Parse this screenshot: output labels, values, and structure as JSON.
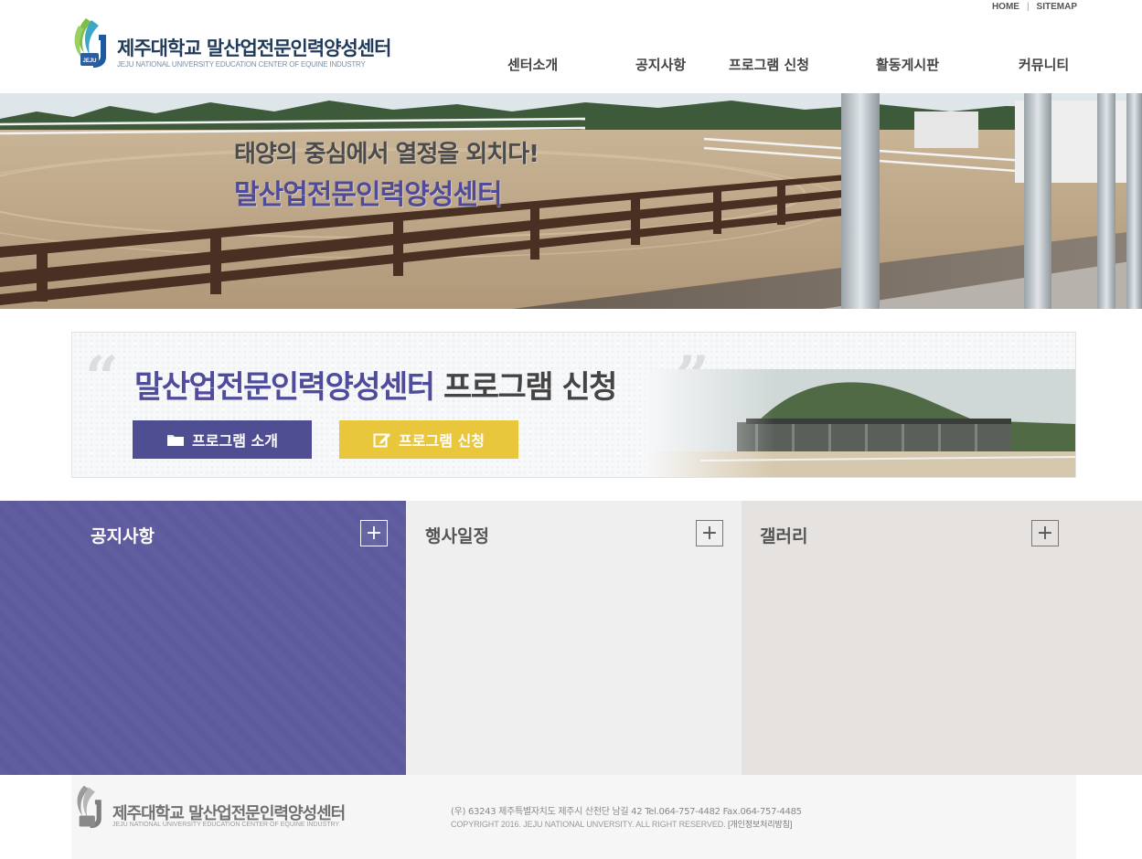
{
  "utility": {
    "home": "HOME",
    "separator": "|",
    "sitemap": "SITEMAP"
  },
  "logo": {
    "title": "제주대학교 말산업전문인력양성센터",
    "subtitle": "JEJU NATIONAL UNIVERSITY EDUCATION CENTER OF EQUINE INDUSTRY",
    "emblem_text": "JEJU"
  },
  "nav": [
    {
      "label": "센터소개"
    },
    {
      "label": "공지사항"
    },
    {
      "label": "프로그램 신청"
    },
    {
      "label": "활동게시판"
    },
    {
      "label": "커뮤니티"
    }
  ],
  "hero": {
    "line1": "태양의 중심에서 열정을 외치다!",
    "line2": "말산업전문인력양성센터"
  },
  "banner": {
    "quote_open": "“",
    "quote_close": "”",
    "title_accent": "말산업전문인력양성센터",
    "title_plain": "프로그램 신청",
    "btn_intro": "프로그램 소개",
    "btn_apply": "프로그램 신청"
  },
  "panels": {
    "notice": {
      "title": "공지사항",
      "more": "+"
    },
    "event": {
      "title": "행사일정",
      "more": "+"
    },
    "gallery": {
      "title": "갤러리",
      "more": "+"
    }
  },
  "footer": {
    "title": "제주대학교 말산업전문인력양성센터",
    "subtitle": "JEJU NATIONAL UNIVERSITY EDUCATION CENTER OF EQUINE INDUSTRY",
    "address": "(우) 63243  제주특별자치도 제주시 산천단 남길 42 Tel.064-757-4482    Fax.064-757-4485",
    "copyright": "COPYRIGHT 2016. JEJU NATIONAL UNVERSITY. ALL RIGHT RESERVED.",
    "privacy": "[개인정보처리방침]"
  },
  "colors": {
    "brand_purple": "#5d5a9e",
    "button_purple": "#4f4e93",
    "button_yellow": "#e9c73c",
    "logo_navy": "#1f3a5a"
  }
}
